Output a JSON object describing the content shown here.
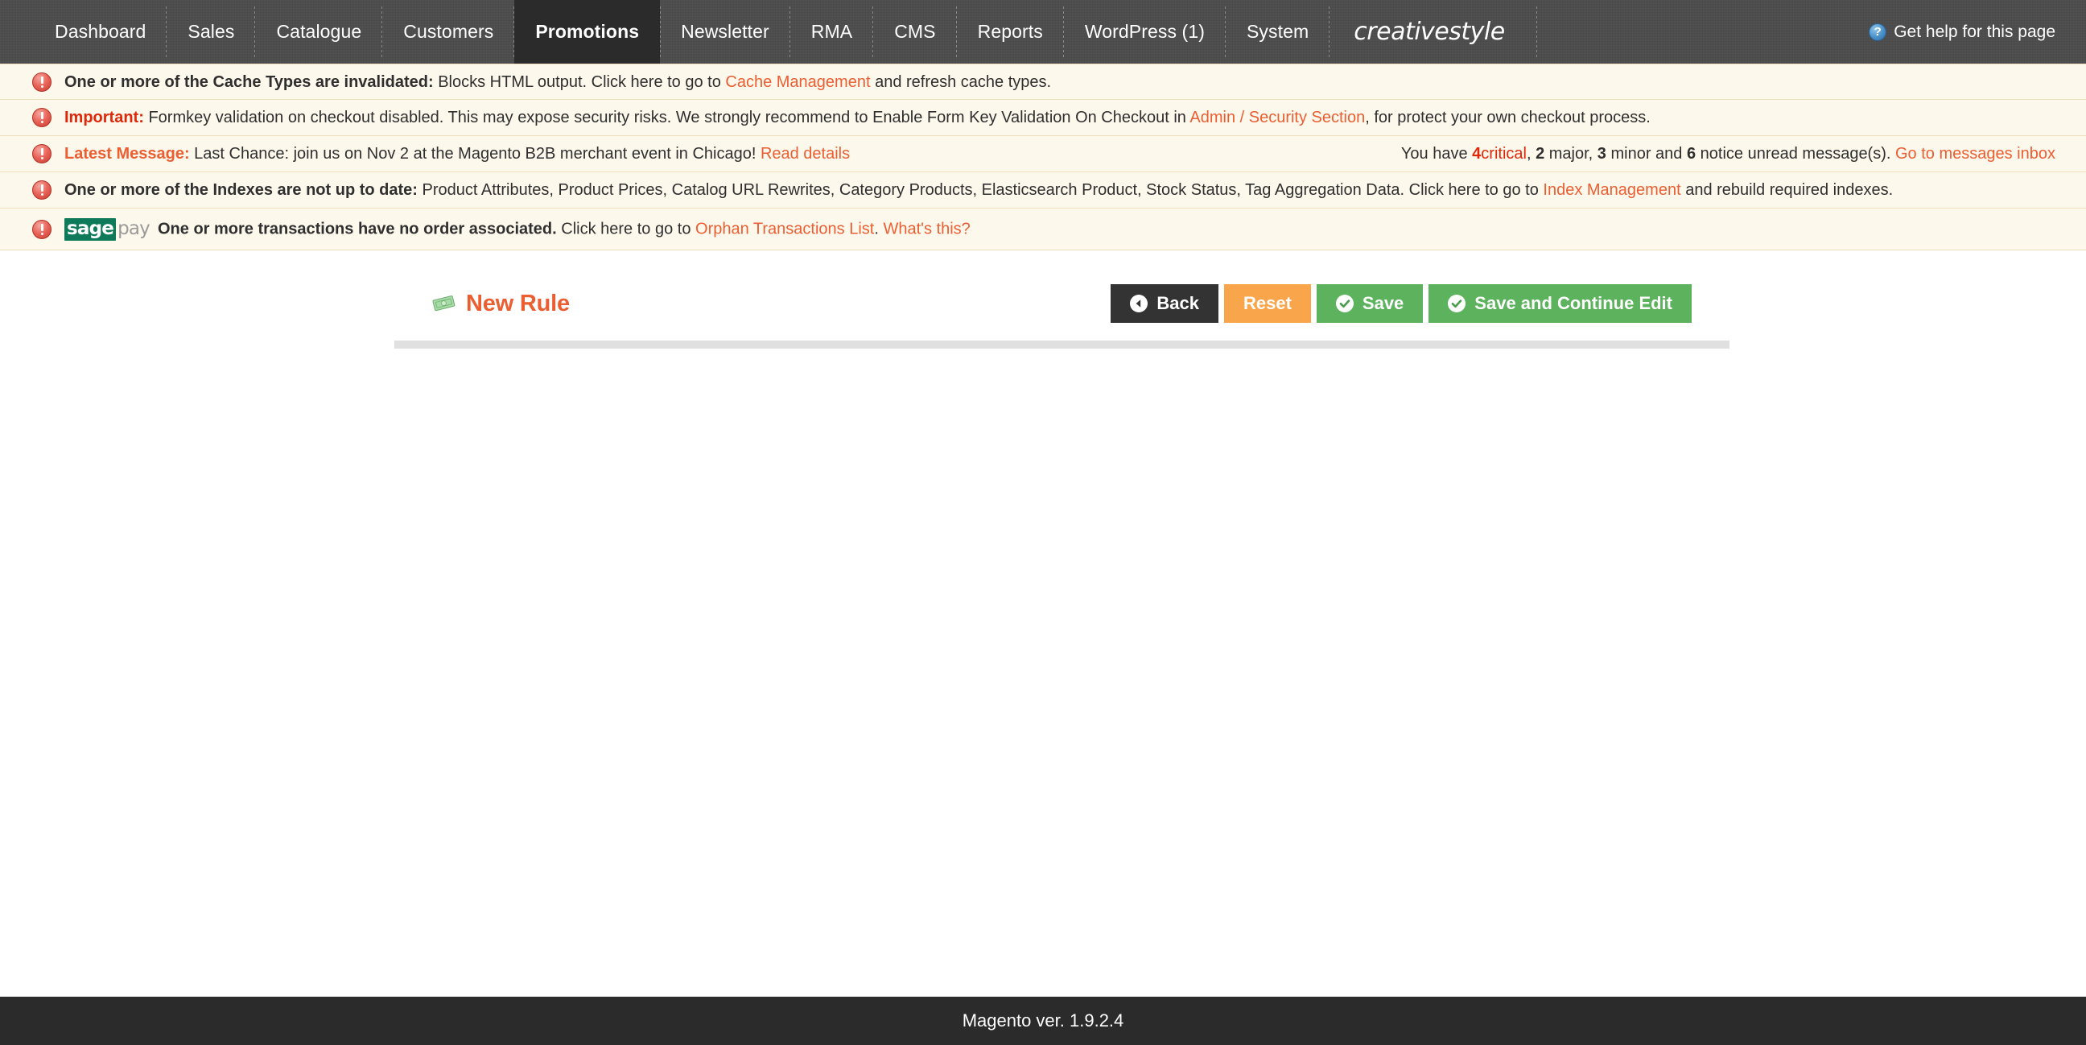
{
  "nav": {
    "items": [
      {
        "label": "Dashboard",
        "active": false
      },
      {
        "label": "Sales",
        "active": false
      },
      {
        "label": "Catalogue",
        "active": false
      },
      {
        "label": "Customers",
        "active": false
      },
      {
        "label": "Promotions",
        "active": true
      },
      {
        "label": "Newsletter",
        "active": false
      },
      {
        "label": "RMA",
        "active": false
      },
      {
        "label": "CMS",
        "active": false
      },
      {
        "label": "Reports",
        "active": false
      },
      {
        "label": "WordPress (1)",
        "active": false
      },
      {
        "label": "System",
        "active": false
      }
    ],
    "logo": "creativestyle",
    "help_label": "Get help for this page",
    "help_icon": "question-mark-circle-icon"
  },
  "messages": [
    {
      "icon": "warning-icon",
      "bold_prefix": "One or more of the Cache Types are invalidated:",
      "text_before": " Blocks HTML output. Click here to go to ",
      "link": "Cache Management",
      "text_after": " and refresh cache types."
    },
    {
      "icon": "warning-icon",
      "red_prefix": "Important:",
      "text_before": " Formkey validation on checkout disabled. This may expose security risks. We strongly recommend to Enable Form Key Validation On Checkout in ",
      "link": "Admin / Security Section",
      "text_after": ", for protect your own checkout process."
    },
    {
      "icon": "warning-icon",
      "orange_prefix": "Latest Message:",
      "text_before": " Last Chance: join us on Nov 2 at the Magento B2B merchant event in Chicago! ",
      "link": "Read details",
      "text_after": "",
      "right": {
        "prefix": "You have ",
        "critical_count": "4",
        "critical_label": "critical",
        "sep1": ", ",
        "major_count": "2",
        "major_label": " major, ",
        "minor_count": "3",
        "minor_label": " minor and ",
        "notice_count": "6",
        "notice_label": " notice unread message(s). ",
        "link": "Go to messages inbox"
      }
    },
    {
      "icon": "warning-icon",
      "bold_prefix": "One or more of the Indexes are not up to date:",
      "text_before": " Product Attributes, Product Prices, Catalog URL Rewrites, Category Products, Elasticsearch Product, Stock Status, Tag Aggregation Data. Click here to go to ",
      "link": "Index Management",
      "text_after": " and rebuild required indexes."
    },
    {
      "icon": "warning-icon",
      "logo": {
        "name": "sagepay-logo",
        "part1": "sage",
        "part2": "pay"
      },
      "bold_prefix": "One or more transactions have no order associated.",
      "text_before": " Click here to go to ",
      "link": "Orphan Transactions List",
      "text_mid": ". ",
      "link2": "What's this?",
      "text_after": ""
    }
  ],
  "page": {
    "title": "New Rule",
    "title_icon": "money-banknote-icon",
    "buttons": [
      {
        "label": "Back",
        "style": "dark",
        "icon": "back-arrow-icon"
      },
      {
        "label": "Reset",
        "style": "orange",
        "icon": null
      },
      {
        "label": "Save",
        "style": "green",
        "icon": "check-circle-icon"
      },
      {
        "label": "Save and Continue Edit",
        "style": "green",
        "icon": "check-circle-icon"
      }
    ]
  },
  "footer": {
    "text": "Magento ver. 1.9.2.4"
  },
  "colors": {
    "accent_orange": "#eb5e32",
    "critical_red": "#df280a",
    "green": "#5cb25d",
    "button_orange": "#f9a54c",
    "nav_bg": "#4b4b4b",
    "nav_active": "#2b2b2b",
    "message_bg": "#fdf8ec"
  }
}
